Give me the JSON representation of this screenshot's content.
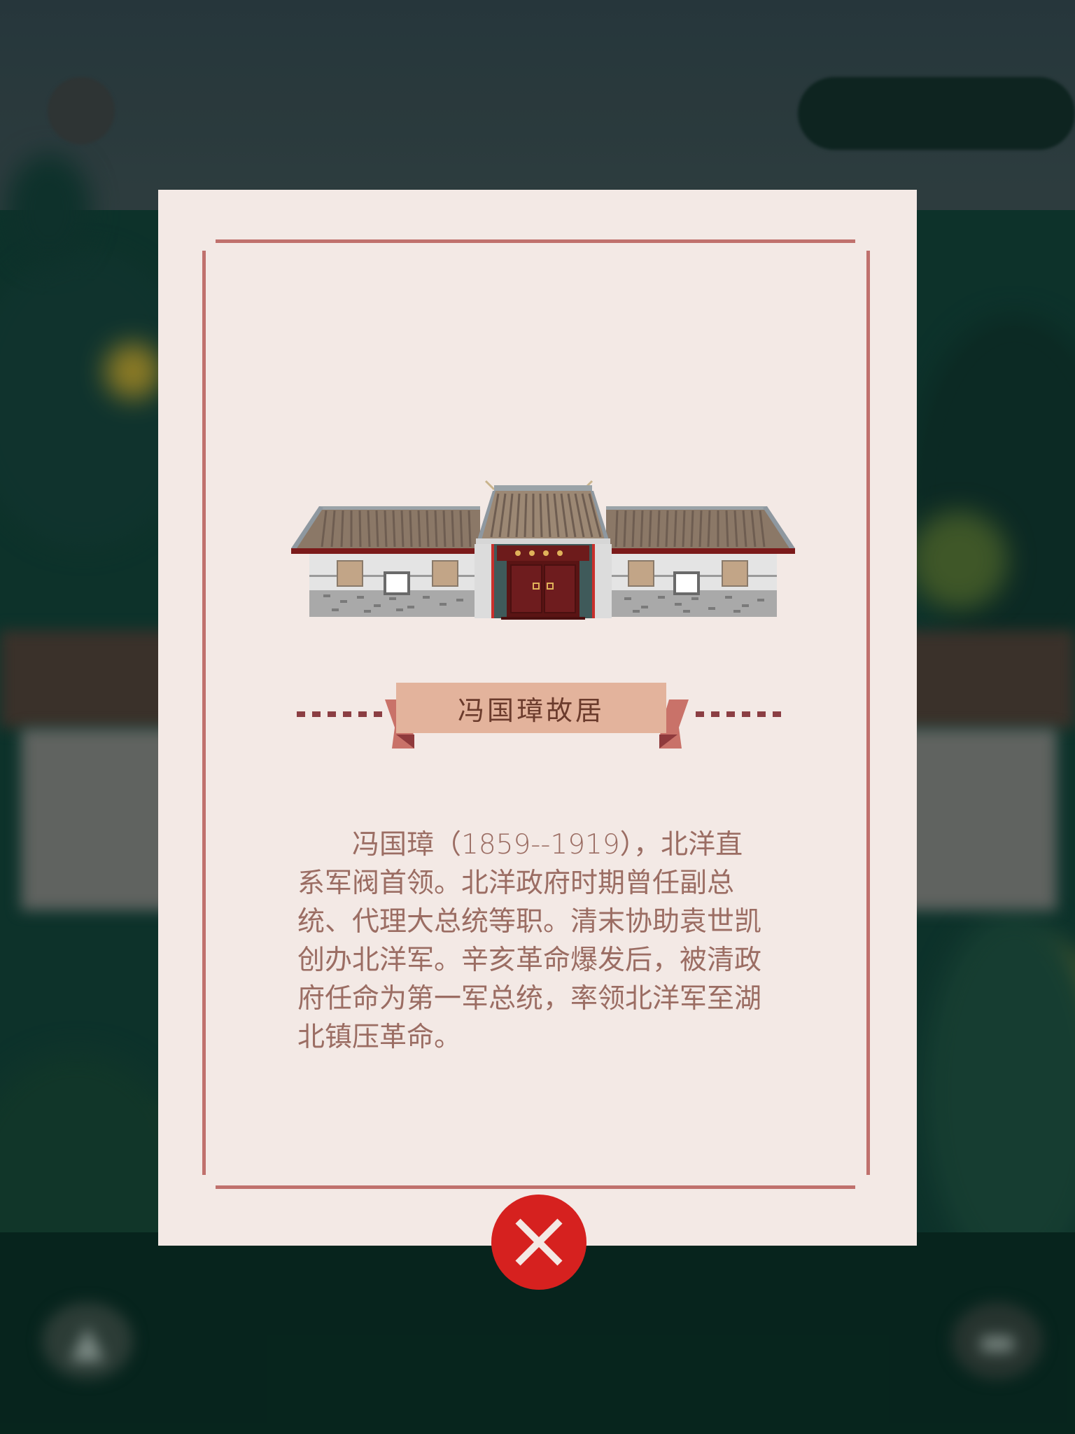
{
  "modal": {
    "title": "冯国璋故居",
    "description_lines": [
      "　　冯国璋（1859--1919），北洋直",
      "系军阀首领。北洋政府时期曾任副总",
      "统、代理大总统等职。清末协助袁世凯",
      "创办北洋军。辛亥革命爆发后，被清政",
      "府任命为第一军总统，率领北洋军至湖",
      "北镇压革命。"
    ],
    "close_icon": "close-x-icon"
  },
  "background": {
    "home_icon": "▲",
    "map_icon": "▬"
  },
  "colors": {
    "card_bg": "#f3e9e5",
    "frame": "#c0716d",
    "ribbon": "#e3b39c",
    "ribbon_text": "#6b3b2c",
    "body_text": "#9b6d63",
    "close_button": "#d6211f"
  }
}
